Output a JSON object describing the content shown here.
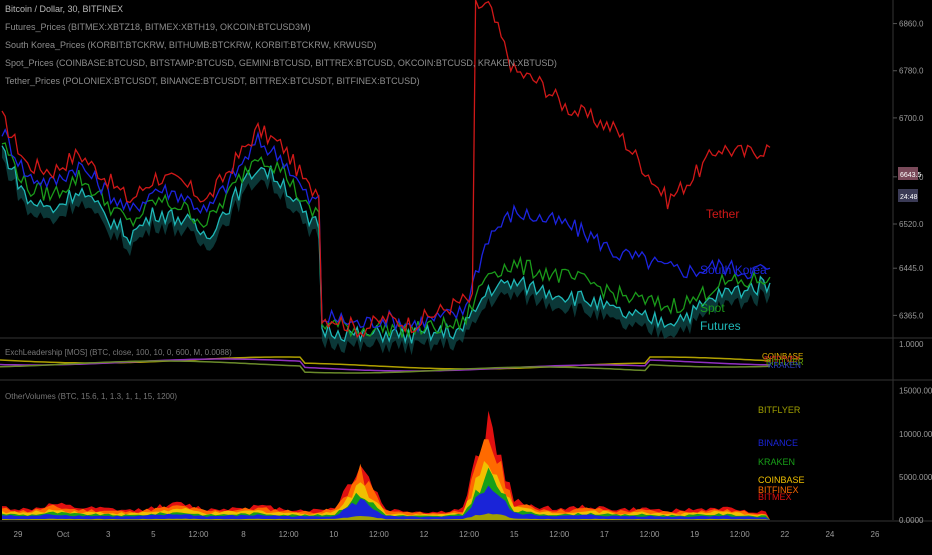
{
  "header": {
    "title": "Bitcoin / Dollar, 30, BITFINEX",
    "indicators": [
      "Futures_Prices (BITMEX:XBTZ18, BITMEX:XBTH19, OKCOIN:BTCUSD3M)",
      "South Korea_Prices (KORBIT:BTCKRW, BITHUMB:BTCKRW, KORBIT:BTCKRW, KRWUSD)",
      "Spot_Prices (COINBASE:BTCUSD, BITSTAMP:BTCUSD, GEMINI:BTCUSD, BITTREX:BTCUSD, OKCOIN:BTCUSD, KRAKEN:XBTUSD)",
      "Tether_Prices (POLONIEX:BTCUSDT, BINANCE:BTCUSDT, BITTREX:BTCUSDT, BITFINEX:BTCUSD)"
    ]
  },
  "colors": {
    "background": "#000000",
    "tether": "#d01818",
    "south_korea": "#1c24e0",
    "spot": "#1a9a1a",
    "futures": "#1fb8b8",
    "grid": "#141414",
    "axis_text": "#9a9a9a"
  },
  "chart_data": [
    {
      "type": "line",
      "panel": "price",
      "yticks": [
        6365.0,
        6445.0,
        6520.0,
        6600.0,
        6700.0,
        6780.0,
        6860.0
      ],
      "ylim": [
        6330,
        6900
      ],
      "series_labels": [
        "Tether",
        "South Korea",
        "Spot",
        "Futures"
      ],
      "x_index": [
        0,
        4,
        8,
        12,
        16,
        20,
        24,
        28,
        32,
        36,
        40,
        44,
        48,
        52,
        56,
        60,
        64,
        68,
        72,
        76,
        80,
        84,
        88,
        92,
        96,
        100,
        104,
        108,
        112,
        116,
        120
      ],
      "series": [
        {
          "name": "Tether",
          "values": [
            6700,
            6620,
            6610,
            6640,
            6600,
            6560,
            6600,
            6590,
            6560,
            6620,
            6680,
            6650,
            6580,
            6360,
            6340,
            6360,
            6350,
            6370,
            6390,
            6890,
            6780,
            6760,
            6720,
            6700,
            6680,
            6620,
            6560,
            6600,
            6650,
            6640,
            6650
          ]
        },
        {
          "name": "South Korea",
          "values": [
            6680,
            6600,
            6590,
            6620,
            6580,
            6540,
            6580,
            6570,
            6540,
            6600,
            6660,
            6630,
            6560,
            6360,
            6350,
            6360,
            6350,
            6360,
            6370,
            6500,
            6540,
            6530,
            6520,
            6500,
            6470,
            6460,
            6445,
            6440,
            6450,
            6440,
            6445
          ]
        },
        {
          "name": "Spot",
          "values": [
            6660,
            6580,
            6570,
            6600,
            6560,
            6520,
            6560,
            6550,
            6520,
            6580,
            6640,
            6610,
            6540,
            6350,
            6340,
            6345,
            6340,
            6345,
            6350,
            6440,
            6450,
            6440,
            6430,
            6420,
            6400,
            6390,
            6380,
            6390,
            6420,
            6420,
            6430
          ]
        },
        {
          "name": "Futures",
          "values": [
            6650,
            6560,
            6545,
            6580,
            6535,
            6500,
            6540,
            6530,
            6500,
            6560,
            6620,
            6590,
            6520,
            6340,
            6330,
            6335,
            6330,
            6335,
            6340,
            6410,
            6420,
            6410,
            6400,
            6390,
            6370,
            6360,
            6355,
            6370,
            6400,
            6410,
            6420
          ]
        }
      ],
      "last_values": [
        "6643.5",
        "24:48"
      ]
    },
    {
      "type": "line",
      "panel": "leadership",
      "label": "ExchLeadership [MOS] (BTC, close, 100, 10, 0, 600, M, 0.0088)",
      "yticks": [
        1.0
      ],
      "ylim": [
        0,
        1.2
      ],
      "series_labels": [
        "COINBASE",
        "BITFINEX",
        "BITFLYER",
        "KRAKEN"
      ]
    },
    {
      "type": "area",
      "panel": "volumes",
      "label": "OtherVolumes (BTC, 15.6, 1, 1.3, 1, 1, 15, 1200)",
      "yticks": [
        15000.0,
        10000.0,
        5000.0,
        0.0
      ],
      "ylim": [
        0,
        16000
      ],
      "series_labels": [
        "BITFLYER",
        "BINANCE",
        "KRAKEN",
        "COINBASE",
        "BITFINEX",
        "BITMEX"
      ],
      "x_index": [
        0,
        4,
        8,
        12,
        16,
        20,
        24,
        28,
        32,
        36,
        40,
        44,
        48,
        52,
        56,
        60,
        64,
        68,
        72,
        76,
        80,
        84,
        88,
        92,
        96,
        100,
        104,
        108,
        112,
        116,
        120
      ],
      "stack_total": [
        1500,
        1200,
        1800,
        1400,
        1300,
        1100,
        1500,
        1900,
        1200,
        1400,
        1600,
        1300,
        1100,
        1400,
        6500,
        1200,
        1000,
        900,
        1300,
        11500,
        2200,
        1500,
        1300,
        1600,
        1200,
        1300,
        1100,
        1200,
        1400,
        1100,
        900
      ]
    }
  ],
  "x_axis": {
    "ticks": [
      "29",
      "Oct",
      "3",
      "5",
      "12:00",
      "8",
      "12:00",
      "10",
      "12:00",
      "12",
      "12:00",
      "15",
      "12:00",
      "17",
      "12:00",
      "19",
      "12:00",
      "22",
      "24",
      "26"
    ]
  },
  "labels": {
    "tether": "Tether",
    "south_korea": "South Korea",
    "spot": "Spot",
    "futures": "Futures"
  }
}
